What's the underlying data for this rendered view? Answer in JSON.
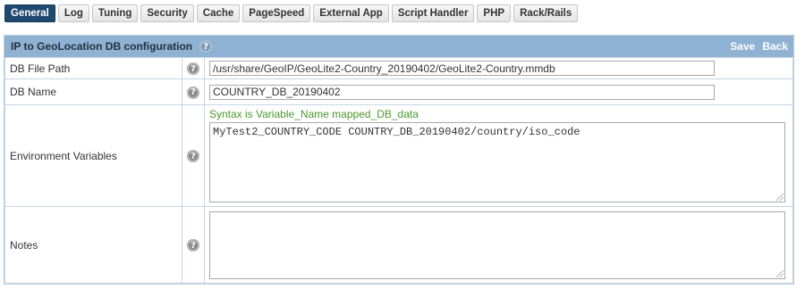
{
  "tabs": [
    {
      "label": "General",
      "active": true
    },
    {
      "label": "Log"
    },
    {
      "label": "Tuning"
    },
    {
      "label": "Security"
    },
    {
      "label": "Cache"
    },
    {
      "label": "PageSpeed"
    },
    {
      "label": "External App"
    },
    {
      "label": "Script Handler"
    },
    {
      "label": "PHP"
    },
    {
      "label": "Rack/Rails"
    }
  ],
  "panel": {
    "title": "IP to GeoLocation DB configuration",
    "help_icon": "question-icon",
    "save_label": "Save",
    "back_label": "Back"
  },
  "fields": {
    "db_file_path": {
      "label": "DB File Path",
      "value": "/usr/share/GeoIP/GeoLite2-Country_20190402/GeoLite2-Country.mmdb"
    },
    "db_name": {
      "label": "DB Name",
      "value": "COUNTRY_DB_20190402"
    },
    "env_vars": {
      "label": "Environment Variables",
      "syntax_hint": "Syntax is Variable_Name mapped_DB_data",
      "value": "MyTest2_COUNTRY_CODE COUNTRY_DB_20190402/country/iso_code"
    },
    "notes": {
      "label": "Notes",
      "value": ""
    }
  },
  "colors": {
    "active_tab": "#1f4a70",
    "header_bg": "#8fb2d3",
    "syntax_hint": "#4a9a2a"
  }
}
